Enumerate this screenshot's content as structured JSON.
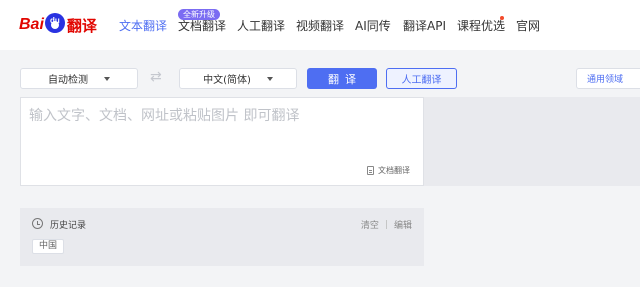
{
  "logo": {
    "brand_text": "Bai",
    "paw_text": "du",
    "product": "翻译"
  },
  "nav": {
    "items": [
      {
        "label": "文本翻译"
      },
      {
        "label": "文档翻译"
      },
      {
        "label": "人工翻译"
      },
      {
        "label": "视频翻译"
      },
      {
        "label": "AI同传"
      },
      {
        "label": "翻译API"
      },
      {
        "label": "课程优选"
      },
      {
        "label": "官网"
      }
    ],
    "badge": "全新升级"
  },
  "toolbar": {
    "source_lang": "自动检测",
    "target_lang": "中文(简体)",
    "swap_icon": "⇄",
    "translate_label": "翻译",
    "human_label": "人工翻译",
    "domain_label": "通用领域"
  },
  "input": {
    "placeholder": "输入文字、文档、网址或粘贴图片 即可翻译",
    "doc_link": "文档翻译"
  },
  "history": {
    "title": "历史记录",
    "clear": "清空",
    "edit": "编辑",
    "tags": [
      "中国"
    ]
  },
  "colors": {
    "accent": "#4e6ef2",
    "brand_red": "#e10601",
    "brand_blue": "#2932e1",
    "badge": "#7b6cf2"
  }
}
